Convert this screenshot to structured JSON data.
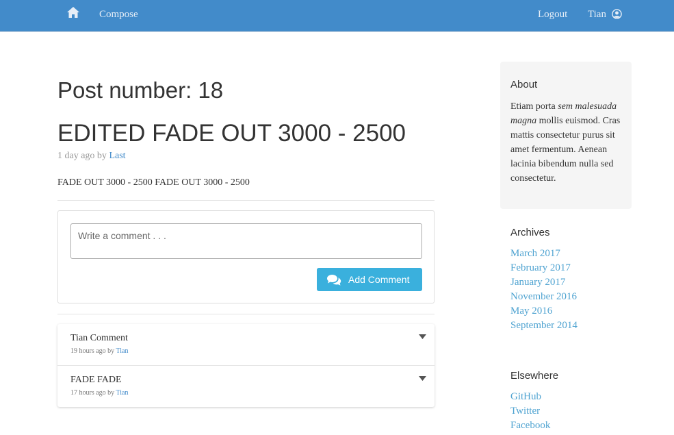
{
  "navbar": {
    "compose_label": "Compose",
    "logout_label": "Logout",
    "user_label": "Tian",
    "home_icon": "home-icon",
    "user_icon": "user-circle-icon",
    "color": "#428bca"
  },
  "post": {
    "number_label": "Post number: 18",
    "title": "EDITED FADE OUT 3000 - 2500",
    "meta_prefix": "1 day ago by ",
    "author": "Last",
    "body": "FADE OUT 3000 - 2500 FADE OUT 3000 - 2500"
  },
  "comment_form": {
    "placeholder": "Write a comment . . .",
    "value": "",
    "button_label": "Add Comment",
    "button_icon": "comments-icon",
    "button_color": "#3ab0dd"
  },
  "comments": [
    {
      "title": "Tian Comment",
      "meta_prefix": "19 hours ago by ",
      "author": "Tian"
    },
    {
      "title": "FADE FADE",
      "meta_prefix": "17 hours ago by ",
      "author": "Tian"
    }
  ],
  "sidebar": {
    "about": {
      "title": "About",
      "text_1": "Etiam porta ",
      "text_em": "sem malesuada magna",
      "text_2": " mollis euismod. Cras mattis consectetur purus sit amet fermentum. Aenean lacinia bibendum nulla sed consectetur."
    },
    "archives": {
      "title": "Archives",
      "items": [
        "March 2017",
        "February 2017",
        "January 2017",
        "November 2016",
        "May 2016",
        "September 2014"
      ]
    },
    "elsewhere": {
      "title": "Elsewhere",
      "items": [
        "GitHub",
        "Twitter",
        "Facebook"
      ]
    }
  }
}
